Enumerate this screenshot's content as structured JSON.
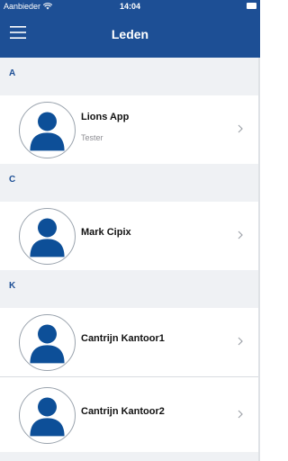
{
  "status_bar": {
    "carrier": "Aanbieder",
    "time": "14:04",
    "wifi_icon": "wifi-icon",
    "battery_icon": "battery-icon"
  },
  "nav": {
    "title": "Leden",
    "menu_icon": "hamburger-menu-icon"
  },
  "sections": [
    {
      "letter": "A",
      "members": [
        {
          "name": "Lions App",
          "subtitle": "Tester"
        }
      ]
    },
    {
      "letter": "C",
      "members": [
        {
          "name": "Mark Cipix",
          "subtitle": ""
        }
      ]
    },
    {
      "letter": "K",
      "members": [
        {
          "name": "Cantrijn Kantoor1",
          "subtitle": ""
        },
        {
          "name": "Cantrijn Kantoor2",
          "subtitle": ""
        }
      ]
    }
  ],
  "colors": {
    "brand": "#1d4f95",
    "section_background": "#eff1f4",
    "avatar_fill": "#0d4f98"
  },
  "icons": {
    "avatar": "person-avatar-icon",
    "chevron": "chevron-right-icon"
  }
}
